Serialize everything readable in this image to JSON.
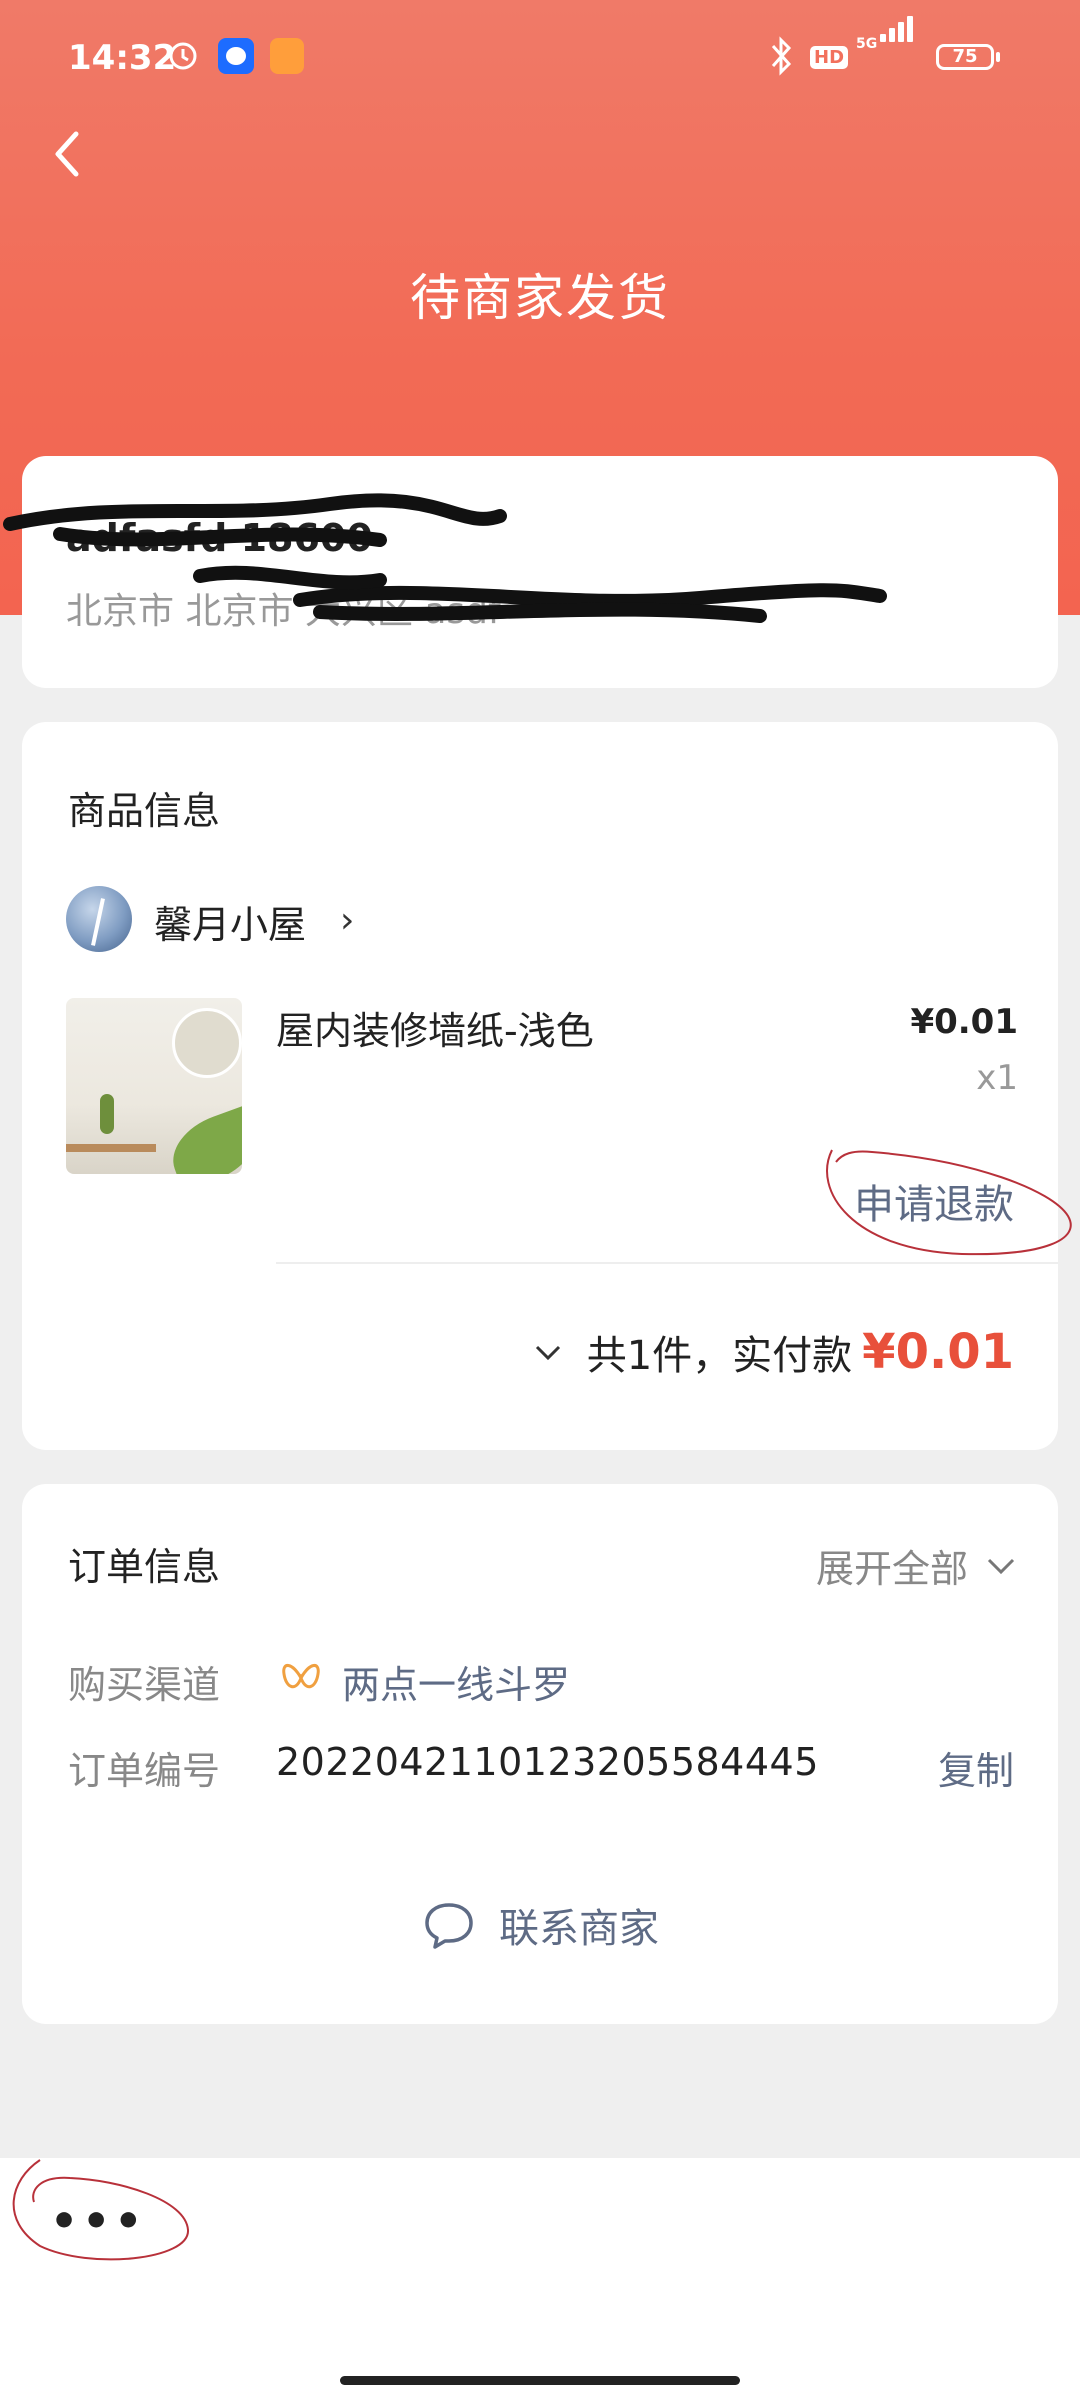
{
  "status_bar": {
    "time": "14:32",
    "network": "5G",
    "hd": "HD",
    "battery": "75"
  },
  "header": {
    "title": "待商家发货",
    "back_icon": "chevron-left-icon"
  },
  "address": {
    "name_phone": "adfasfd 18600",
    "detail": "北京市 北京市 大兴区 asdf"
  },
  "product_section": {
    "title": "商品信息",
    "shop_name": "馨月小屋",
    "product_name": "屋内装修墙纸-浅色",
    "price": "¥0.01",
    "quantity": "x1",
    "refund_label": "申请退款",
    "total_label": "共1件，实付款",
    "total_amount": "¥0.01",
    "accent_color": "#e8503b"
  },
  "order_section": {
    "title": "订单信息",
    "expand_label": "展开全部",
    "channel_label": "购买渠道",
    "channel_value": "两点一线斗罗",
    "order_no_label": "订单编号",
    "order_no_value": "20220421101232055844​45",
    "copy_label": "复制",
    "contact_label": "联系商家"
  },
  "bottom_bar": {
    "more_label": "•••"
  }
}
